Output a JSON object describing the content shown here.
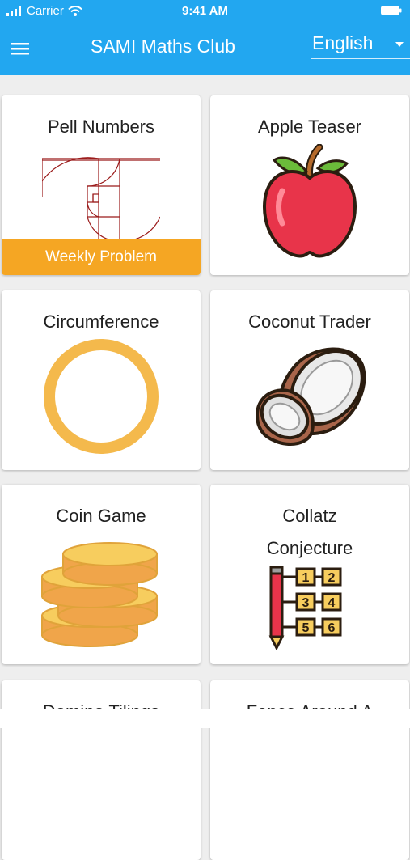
{
  "status_bar": {
    "carrier": "Carrier",
    "time": "9:41 AM"
  },
  "app_bar": {
    "title": "SAMI Maths Club",
    "language": "English",
    "menu_icon": "hamburger-menu-icon"
  },
  "colors": {
    "primary": "#22a7f0",
    "banner": "#f5a623",
    "background": "#eeeeee"
  },
  "cards": [
    {
      "title": "Pell Numbers",
      "icon": "pell-spiral-icon",
      "banner": "Weekly Problem"
    },
    {
      "title": "Apple Teaser",
      "icon": "apple-icon"
    },
    {
      "title": "Circumference",
      "icon": "circle-ring-icon"
    },
    {
      "title": "Coconut Trader",
      "icon": "coconut-icon"
    },
    {
      "title": "Coin Game",
      "icon": "coin-stack-icon"
    },
    {
      "title_line1": "Collatz",
      "title_line2": "Conjecture",
      "icon": "number-grid-pencil-icon",
      "numbers": [
        "1",
        "2",
        "3",
        "4",
        "5",
        "6"
      ]
    },
    {
      "title": "Domino Tilings"
    },
    {
      "title": "Fence Around A"
    }
  ]
}
